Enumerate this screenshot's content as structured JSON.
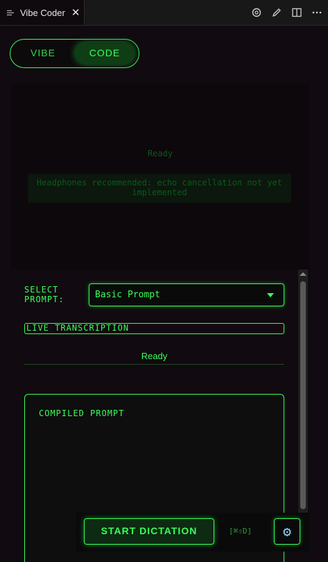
{
  "tab": {
    "title": "Vibe Coder",
    "icon": "list-icon"
  },
  "toolbar": {
    "icons": [
      "openai-icon",
      "edit-icon",
      "split-editor-icon",
      "more-icon"
    ]
  },
  "mode_toggle": {
    "options": [
      "VIBE",
      "CODE"
    ],
    "selected": "CODE"
  },
  "visualizer": {
    "status": "Ready",
    "notice": "Headphones recommended: echo cancellation not yet implemented"
  },
  "prompt_select": {
    "label": "SELECT\nPROMPT:",
    "value": "Basic Prompt"
  },
  "live_transcription": {
    "label": "LIVE TRANSCRIPTION",
    "status": "Ready"
  },
  "compiled_prompt": {
    "title": "COMPILED PROMPT"
  },
  "actions": {
    "start_label": "START DICTATION",
    "shortcut": "[⌘⇧D]",
    "settings_icon": "gear-icon"
  },
  "colors": {
    "accent": "#39ff5a",
    "background": "#110a10",
    "dim": "#0b5a1b"
  }
}
